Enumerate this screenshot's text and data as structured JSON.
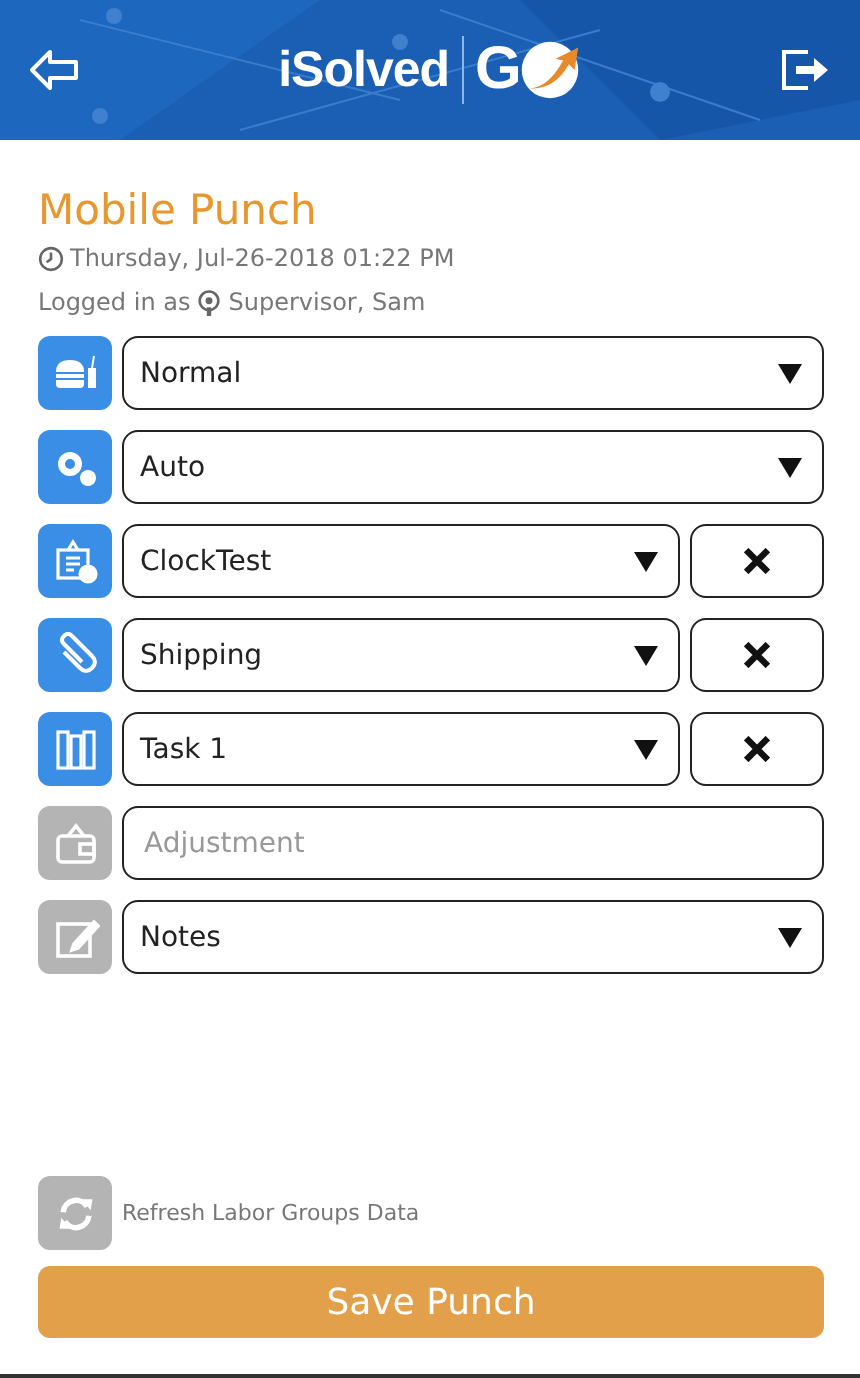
{
  "header": {
    "logo": "iSolved",
    "logo_mark": "G"
  },
  "title": "Mobile Punch",
  "datetime": "Thursday, Jul-26-2018 01:22 PM",
  "logged_in": {
    "label": "Logged in as",
    "user": "Supervisor, Sam"
  },
  "rows": [
    {
      "kind": "select",
      "enabled": true,
      "value": "Normal"
    },
    {
      "kind": "select",
      "enabled": true,
      "value": "Auto"
    },
    {
      "kind": "select-clearable",
      "enabled": true,
      "value": "ClockTest"
    },
    {
      "kind": "select-clearable",
      "enabled": true,
      "value": "Shipping"
    },
    {
      "kind": "select-clearable",
      "enabled": true,
      "value": "Task 1"
    },
    {
      "kind": "input",
      "enabled": false,
      "placeholder": "Adjustment"
    },
    {
      "kind": "select",
      "enabled": false,
      "value": "Notes"
    }
  ],
  "refresh": {
    "label": "Refresh Labor Groups Data",
    "enabled": false
  },
  "save_button": "Save Punch"
}
